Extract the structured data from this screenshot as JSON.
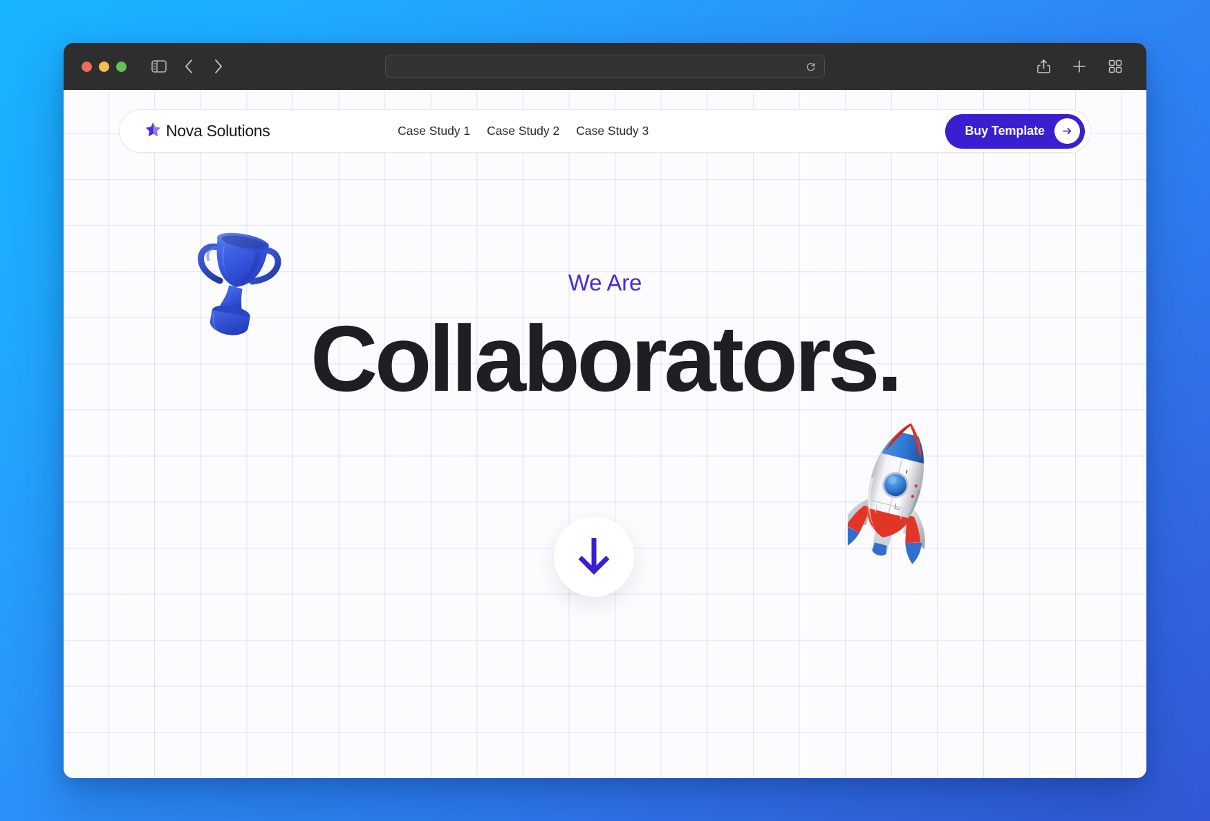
{
  "background": {
    "gradient_from": "#18b4ff",
    "gradient_to": "#3357d6"
  },
  "browser": {
    "traffic_lights": [
      {
        "name": "close",
        "color": "#ee6a5f"
      },
      {
        "name": "minimize",
        "color": "#f5bd4f"
      },
      {
        "name": "maximize",
        "color": "#61c454"
      }
    ],
    "sidebar_icon": "sidebar-toggle-icon",
    "back_icon": "chevron-left-icon",
    "forward_icon": "chevron-right-icon",
    "address_bar": {
      "value": "",
      "placeholder": "",
      "reload_icon": "reload-icon"
    },
    "right_icons": [
      {
        "name": "share-icon"
      },
      {
        "name": "new-tab-icon"
      },
      {
        "name": "tab-overview-icon"
      }
    ]
  },
  "site": {
    "navbar": {
      "logo_icon": "star-logo-icon",
      "brand": "Nova Solutions",
      "links": [
        {
          "label": "Case Study 1"
        },
        {
          "label": "Case Study 2"
        },
        {
          "label": "Case Study 3"
        }
      ],
      "cta": {
        "label": "Buy Template",
        "arrow_icon": "arrow-right-icon",
        "bg_color": "#3a1fd0",
        "text_color": "#ffffff"
      }
    },
    "hero": {
      "eyebrow": "We Are",
      "eyebrow_color": "#4b2ad6",
      "headline": "Collaborators.",
      "headline_color": "#1f1f23"
    },
    "scroll_button": {
      "icon": "arrow-down-icon",
      "icon_color": "#3a1fd0"
    },
    "illustrations": [
      {
        "name": "trophy-illustration",
        "alt": "3D blue trophy"
      },
      {
        "name": "rocket-illustration",
        "alt": "3D red white and blue rocket"
      }
    ],
    "grid_line_color": "#6c69dc"
  }
}
